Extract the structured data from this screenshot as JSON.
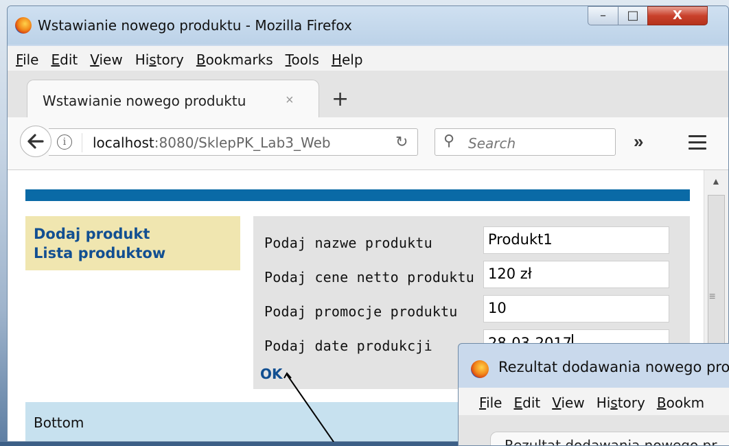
{
  "window": {
    "title": "Wstawianie nowego produktu - Mozilla Firefox",
    "controls": {
      "minimize": "–",
      "maximize": "□",
      "close": "X"
    }
  },
  "menu": [
    {
      "label": "File",
      "accesskey_index": 0
    },
    {
      "label": "Edit",
      "accesskey_index": 0
    },
    {
      "label": "View",
      "accesskey_index": 0
    },
    {
      "label": "History",
      "accesskey_index": 2
    },
    {
      "label": "Bookmarks",
      "accesskey_index": 0
    },
    {
      "label": "Tools",
      "accesskey_index": 0
    },
    {
      "label": "Help",
      "accesskey_index": 0
    }
  ],
  "tab": {
    "label": "Wstawianie nowego produktu",
    "close": "×",
    "new_tab": "+"
  },
  "nav": {
    "url_host": "localhost",
    "url_rest": ":8080/SklepPK_Lab3_Web",
    "search_placeholder": "Search",
    "overflow": "»"
  },
  "page": {
    "links": [
      "Dodaj produkt",
      "Lista produktow"
    ],
    "form": {
      "fields": [
        {
          "label": "Podaj nazwe produktu",
          "value": "Produkt1"
        },
        {
          "label": "Podaj cene netto produktu",
          "value": "120 zł"
        },
        {
          "label": "Podaj promocje produktu",
          "value": "10"
        },
        {
          "label": "Podaj date produkcji",
          "value": "28-03-2017"
        }
      ],
      "submit": "OK"
    },
    "footer": "Bottom"
  },
  "second_window": {
    "title": "Rezultat dodawania nowego pro",
    "menu": [
      {
        "label": "File",
        "accesskey_index": 0
      },
      {
        "label": "Edit",
        "accesskey_index": 0
      },
      {
        "label": "View",
        "accesskey_index": 0
      },
      {
        "label": "History",
        "accesskey_index": 2
      },
      {
        "label": "Bookm",
        "accesskey_index": 0
      }
    ],
    "tab_label": "Rezultat dodawania nowego pr"
  },
  "colors": {
    "accent_band": "#0a6aa6",
    "nav_panel": "#f0e6b0",
    "link": "#124f91",
    "form_panel": "#e3e3e3",
    "footer": "#c7e1ef"
  }
}
